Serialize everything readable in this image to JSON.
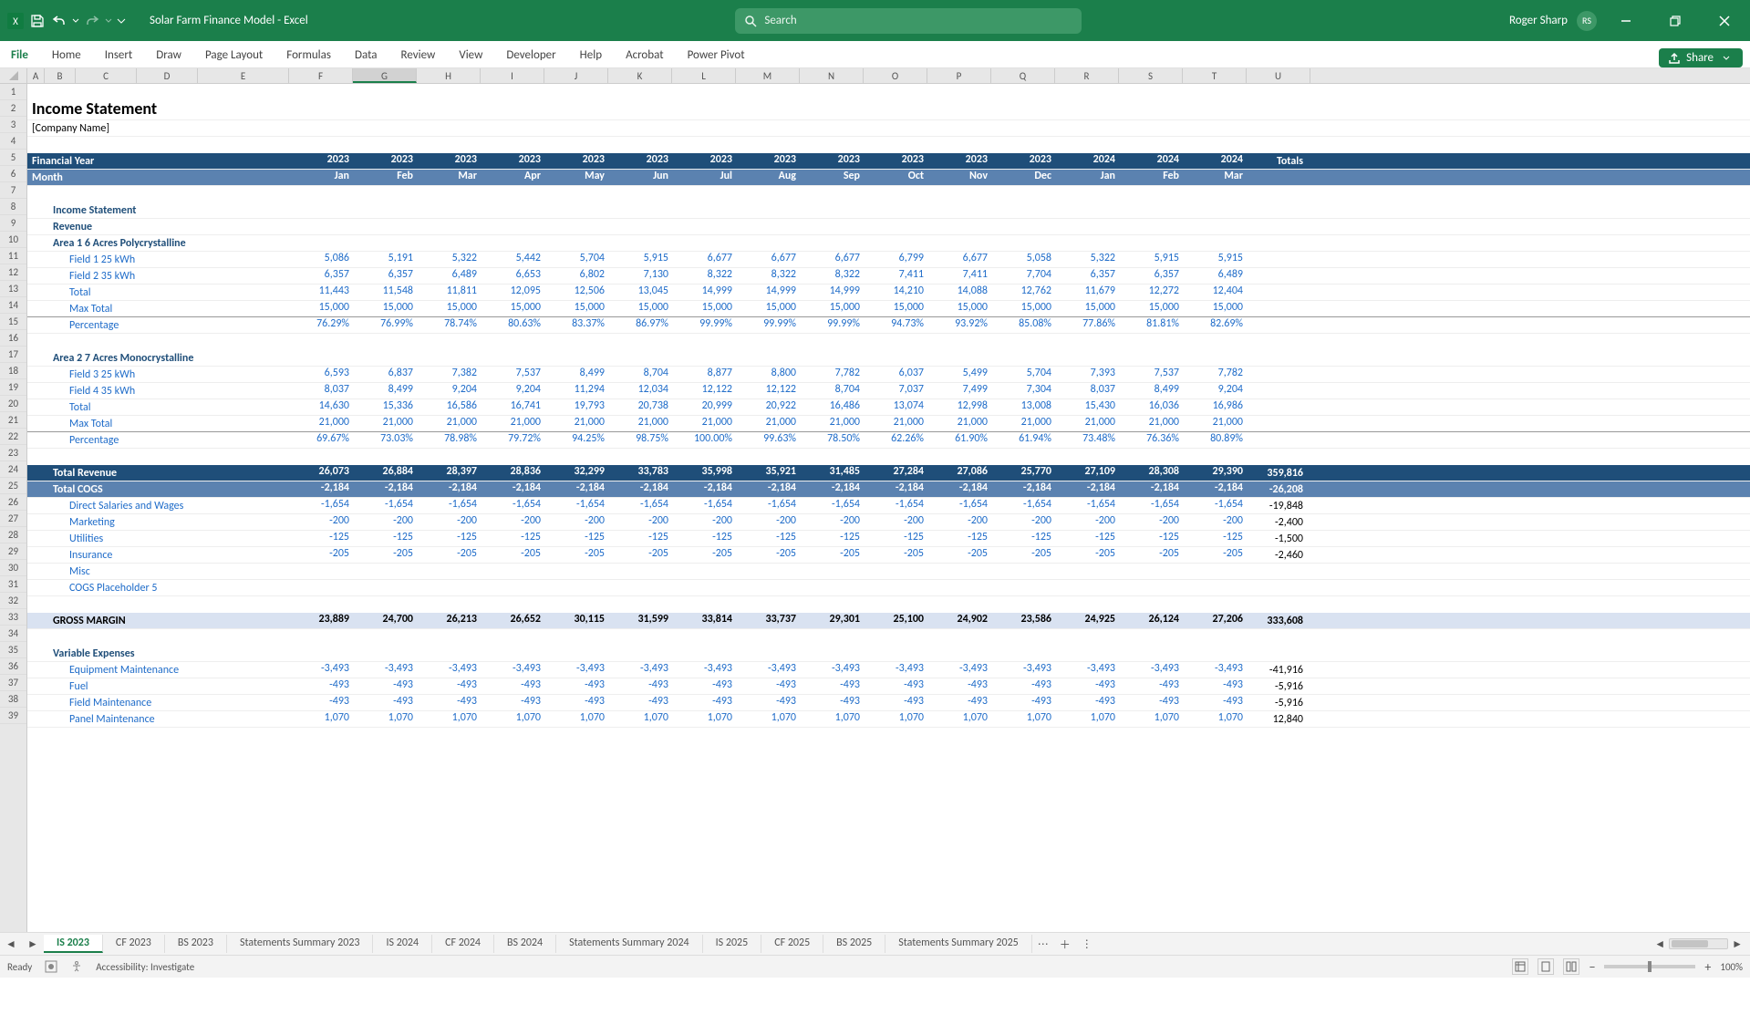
{
  "title": "Solar Farm Finance Model  -  Excel",
  "user": "Roger Sharp",
  "user_initials": "RS",
  "search_placeholder": "Search",
  "ribbon_tabs": [
    "File",
    "Home",
    "Insert",
    "Draw",
    "Page Layout",
    "Formulas",
    "Data",
    "Review",
    "View",
    "Developer",
    "Help",
    "Acrobat",
    "Power Pivot"
  ],
  "share_label": "Share",
  "col_letters": [
    "A",
    "B",
    "C",
    "D",
    "E",
    "F",
    "G",
    "H",
    "I",
    "J",
    "K",
    "L",
    "M",
    "N",
    "O",
    "P",
    "Q",
    "R",
    "S",
    "T",
    "U"
  ],
  "selected_col": "G",
  "sheet": {
    "title": "Income Statement",
    "company": "[Company Name]",
    "finyear_label": "Financial Year",
    "month_label": "Month",
    "years": [
      "2023",
      "2023",
      "2023",
      "2023",
      "2023",
      "2023",
      "2023",
      "2023",
      "2023",
      "2023",
      "2023",
      "2023",
      "2024",
      "2024",
      "2024"
    ],
    "months": [
      "Jan",
      "Feb",
      "Mar",
      "Apr",
      "May",
      "Jun",
      "Jul",
      "Aug",
      "Sep",
      "Oct",
      "Nov",
      "Dec",
      "Jan",
      "Feb",
      "Mar"
    ],
    "totals_label": "Totals",
    "section_labels": {
      "is": "Income Statement",
      "revenue": "Revenue",
      "area1": "Area 1 6 Acres Polycrystalline",
      "area2": "Area 2 7 Acres Monocrystalline",
      "varexp": "Variable Expenses"
    },
    "row_labels": {
      "f1": "Field 1 25 kWh",
      "f2": "Field 2 35 kWh",
      "total": "Total",
      "max": "Max Total",
      "pct": "Percentage",
      "f3": "Field 3 25 kWh",
      "f4": "Field 4 35 kWh",
      "totalrev": "Total Revenue",
      "totalcogs": "Total COGS",
      "dsw": "Direct Salaries and Wages",
      "mkt": "Marketing",
      "util": "Utilities",
      "ins": "Insurance",
      "misc": "Misc",
      "cogs5": "COGS Placeholder 5",
      "gm": "GROSS MARGIN",
      "eqm": "Equipment Maintenance",
      "fuel": "Fuel",
      "fm": "Field Maintenance",
      "pm": "Panel Maintenance"
    },
    "data": {
      "f1": [
        "5,086",
        "5,191",
        "5,322",
        "5,442",
        "5,704",
        "5,915",
        "6,677",
        "6,677",
        "6,677",
        "6,799",
        "6,677",
        "5,058",
        "5,322",
        "5,915",
        "5,915"
      ],
      "f2": [
        "6,357",
        "6,357",
        "6,489",
        "6,653",
        "6,802",
        "7,130",
        "8,322",
        "8,322",
        "8,322",
        "7,411",
        "7,411",
        "7,704",
        "6,357",
        "6,357",
        "6,489"
      ],
      "total1": [
        "11,443",
        "11,548",
        "11,811",
        "12,095",
        "12,506",
        "13,045",
        "14,999",
        "14,999",
        "14,999",
        "14,210",
        "14,088",
        "12,762",
        "11,679",
        "12,272",
        "12,404"
      ],
      "max1": [
        "15,000",
        "15,000",
        "15,000",
        "15,000",
        "15,000",
        "15,000",
        "15,000",
        "15,000",
        "15,000",
        "15,000",
        "15,000",
        "15,000",
        "15,000",
        "15,000",
        "15,000"
      ],
      "pct1": [
        "76.29%",
        "76.99%",
        "78.74%",
        "80.63%",
        "83.37%",
        "86.97%",
        "99.99%",
        "99.99%",
        "99.99%",
        "94.73%",
        "93.92%",
        "85.08%",
        "77.86%",
        "81.81%",
        "82.69%"
      ],
      "f3": [
        "6,593",
        "6,837",
        "7,382",
        "7,537",
        "8,499",
        "8,704",
        "8,877",
        "8,800",
        "7,782",
        "6,037",
        "5,499",
        "5,704",
        "7,393",
        "7,537",
        "7,782"
      ],
      "f4": [
        "8,037",
        "8,499",
        "9,204",
        "9,204",
        "11,294",
        "12,034",
        "12,122",
        "12,122",
        "8,704",
        "7,037",
        "7,499",
        "7,304",
        "8,037",
        "8,499",
        "9,204"
      ],
      "total2": [
        "14,630",
        "15,336",
        "16,586",
        "16,741",
        "19,793",
        "20,738",
        "20,999",
        "20,922",
        "16,486",
        "13,074",
        "12,998",
        "13,008",
        "15,430",
        "16,036",
        "16,986"
      ],
      "max2": [
        "21,000",
        "21,000",
        "21,000",
        "21,000",
        "21,000",
        "21,000",
        "21,000",
        "21,000",
        "21,000",
        "21,000",
        "21,000",
        "21,000",
        "21,000",
        "21,000",
        "21,000"
      ],
      "pct2": [
        "69.67%",
        "73.03%",
        "78.98%",
        "79.72%",
        "94.25%",
        "98.75%",
        "100.00%",
        "99.63%",
        "78.50%",
        "62.26%",
        "61.90%",
        "61.94%",
        "73.48%",
        "76.36%",
        "80.89%"
      ],
      "totalrev": [
        "26,073",
        "26,884",
        "28,397",
        "28,836",
        "32,299",
        "33,783",
        "35,998",
        "35,921",
        "31,485",
        "27,284",
        "27,086",
        "25,770",
        "27,109",
        "28,308",
        "29,390"
      ],
      "totalrev_total": "359,816",
      "totalcogs": [
        "-2,184",
        "-2,184",
        "-2,184",
        "-2,184",
        "-2,184",
        "-2,184",
        "-2,184",
        "-2,184",
        "-2,184",
        "-2,184",
        "-2,184",
        "-2,184",
        "-2,184",
        "-2,184",
        "-2,184"
      ],
      "totalcogs_total": "-26,208",
      "dsw": [
        "-1,654",
        "-1,654",
        "-1,654",
        "-1,654",
        "-1,654",
        "-1,654",
        "-1,654",
        "-1,654",
        "-1,654",
        "-1,654",
        "-1,654",
        "-1,654",
        "-1,654",
        "-1,654",
        "-1,654"
      ],
      "dsw_total": "-19,848",
      "mkt": [
        "-200",
        "-200",
        "-200",
        "-200",
        "-200",
        "-200",
        "-200",
        "-200",
        "-200",
        "-200",
        "-200",
        "-200",
        "-200",
        "-200",
        "-200"
      ],
      "mkt_total": "-2,400",
      "util": [
        "-125",
        "-125",
        "-125",
        "-125",
        "-125",
        "-125",
        "-125",
        "-125",
        "-125",
        "-125",
        "-125",
        "-125",
        "-125",
        "-125",
        "-125"
      ],
      "util_total": "-1,500",
      "ins": [
        "-205",
        "-205",
        "-205",
        "-205",
        "-205",
        "-205",
        "-205",
        "-205",
        "-205",
        "-205",
        "-205",
        "-205",
        "-205",
        "-205",
        "-205"
      ],
      "ins_total": "-2,460",
      "gm": [
        "23,889",
        "24,700",
        "26,213",
        "26,652",
        "30,115",
        "31,599",
        "33,814",
        "33,737",
        "29,301",
        "25,100",
        "24,902",
        "23,586",
        "24,925",
        "26,124",
        "27,206"
      ],
      "gm_total": "333,608",
      "eqm": [
        "-3,493",
        "-3,493",
        "-3,493",
        "-3,493",
        "-3,493",
        "-3,493",
        "-3,493",
        "-3,493",
        "-3,493",
        "-3,493",
        "-3,493",
        "-3,493",
        "-3,493",
        "-3,493",
        "-3,493"
      ],
      "eqm_total": "-41,916",
      "fuel": [
        "-493",
        "-493",
        "-493",
        "-493",
        "-493",
        "-493",
        "-493",
        "-493",
        "-493",
        "-493",
        "-493",
        "-493",
        "-493",
        "-493",
        "-493"
      ],
      "fuel_total": "-5,916",
      "fm": [
        "-493",
        "-493",
        "-493",
        "-493",
        "-493",
        "-493",
        "-493",
        "-493",
        "-493",
        "-493",
        "-493",
        "-493",
        "-493",
        "-493",
        "-493"
      ],
      "fm_total": "-5,916",
      "pm": [
        "1,070",
        "1,070",
        "1,070",
        "1,070",
        "1,070",
        "1,070",
        "1,070",
        "1,070",
        "1,070",
        "1,070",
        "1,070",
        "1,070",
        "1,070",
        "1,070",
        "1,070"
      ],
      "pm_total": "12,840"
    }
  },
  "sheet_tabs": [
    "IS 2023",
    "CF 2023",
    "BS 2023",
    "Statements Summary 2023",
    "IS 2024",
    "CF 2024",
    "BS 2024",
    "Statements Summary 2024",
    "IS 2025",
    "CF 2025",
    "BS 2025",
    "Statements Summary 2025"
  ],
  "active_tab": "IS 2023",
  "status": {
    "ready": "Ready",
    "acc": "Accessibility: Investigate",
    "zoom": "100%"
  }
}
